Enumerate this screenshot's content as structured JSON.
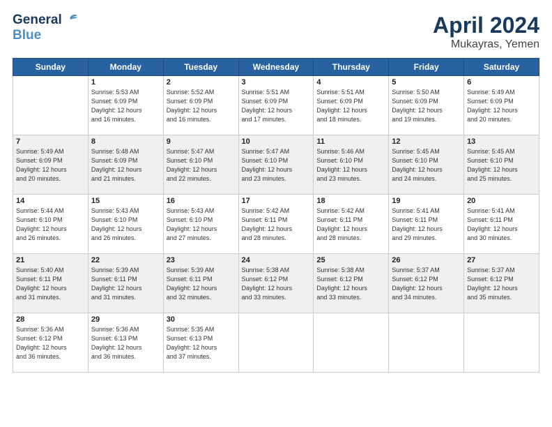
{
  "header": {
    "logo_line1": "General",
    "logo_line2": "Blue",
    "title": "April 2024",
    "location": "Mukayras, Yemen"
  },
  "days_of_week": [
    "Sunday",
    "Monday",
    "Tuesday",
    "Wednesday",
    "Thursday",
    "Friday",
    "Saturday"
  ],
  "weeks": [
    [
      {
        "num": "",
        "info": ""
      },
      {
        "num": "1",
        "info": "Sunrise: 5:53 AM\nSunset: 6:09 PM\nDaylight: 12 hours\nand 16 minutes."
      },
      {
        "num": "2",
        "info": "Sunrise: 5:52 AM\nSunset: 6:09 PM\nDaylight: 12 hours\nand 16 minutes."
      },
      {
        "num": "3",
        "info": "Sunrise: 5:51 AM\nSunset: 6:09 PM\nDaylight: 12 hours\nand 17 minutes."
      },
      {
        "num": "4",
        "info": "Sunrise: 5:51 AM\nSunset: 6:09 PM\nDaylight: 12 hours\nand 18 minutes."
      },
      {
        "num": "5",
        "info": "Sunrise: 5:50 AM\nSunset: 6:09 PM\nDaylight: 12 hours\nand 19 minutes."
      },
      {
        "num": "6",
        "info": "Sunrise: 5:49 AM\nSunset: 6:09 PM\nDaylight: 12 hours\nand 20 minutes."
      }
    ],
    [
      {
        "num": "7",
        "info": "Sunrise: 5:49 AM\nSunset: 6:09 PM\nDaylight: 12 hours\nand 20 minutes."
      },
      {
        "num": "8",
        "info": "Sunrise: 5:48 AM\nSunset: 6:09 PM\nDaylight: 12 hours\nand 21 minutes."
      },
      {
        "num": "9",
        "info": "Sunrise: 5:47 AM\nSunset: 6:10 PM\nDaylight: 12 hours\nand 22 minutes."
      },
      {
        "num": "10",
        "info": "Sunrise: 5:47 AM\nSunset: 6:10 PM\nDaylight: 12 hours\nand 23 minutes."
      },
      {
        "num": "11",
        "info": "Sunrise: 5:46 AM\nSunset: 6:10 PM\nDaylight: 12 hours\nand 23 minutes."
      },
      {
        "num": "12",
        "info": "Sunrise: 5:45 AM\nSunset: 6:10 PM\nDaylight: 12 hours\nand 24 minutes."
      },
      {
        "num": "13",
        "info": "Sunrise: 5:45 AM\nSunset: 6:10 PM\nDaylight: 12 hours\nand 25 minutes."
      }
    ],
    [
      {
        "num": "14",
        "info": "Sunrise: 5:44 AM\nSunset: 6:10 PM\nDaylight: 12 hours\nand 26 minutes."
      },
      {
        "num": "15",
        "info": "Sunrise: 5:43 AM\nSunset: 6:10 PM\nDaylight: 12 hours\nand 26 minutes."
      },
      {
        "num": "16",
        "info": "Sunrise: 5:43 AM\nSunset: 6:10 PM\nDaylight: 12 hours\nand 27 minutes."
      },
      {
        "num": "17",
        "info": "Sunrise: 5:42 AM\nSunset: 6:11 PM\nDaylight: 12 hours\nand 28 minutes."
      },
      {
        "num": "18",
        "info": "Sunrise: 5:42 AM\nSunset: 6:11 PM\nDaylight: 12 hours\nand 28 minutes."
      },
      {
        "num": "19",
        "info": "Sunrise: 5:41 AM\nSunset: 6:11 PM\nDaylight: 12 hours\nand 29 minutes."
      },
      {
        "num": "20",
        "info": "Sunrise: 5:41 AM\nSunset: 6:11 PM\nDaylight: 12 hours\nand 30 minutes."
      }
    ],
    [
      {
        "num": "21",
        "info": "Sunrise: 5:40 AM\nSunset: 6:11 PM\nDaylight: 12 hours\nand 31 minutes."
      },
      {
        "num": "22",
        "info": "Sunrise: 5:39 AM\nSunset: 6:11 PM\nDaylight: 12 hours\nand 31 minutes."
      },
      {
        "num": "23",
        "info": "Sunrise: 5:39 AM\nSunset: 6:11 PM\nDaylight: 12 hours\nand 32 minutes."
      },
      {
        "num": "24",
        "info": "Sunrise: 5:38 AM\nSunset: 6:12 PM\nDaylight: 12 hours\nand 33 minutes."
      },
      {
        "num": "25",
        "info": "Sunrise: 5:38 AM\nSunset: 6:12 PM\nDaylight: 12 hours\nand 33 minutes."
      },
      {
        "num": "26",
        "info": "Sunrise: 5:37 AM\nSunset: 6:12 PM\nDaylight: 12 hours\nand 34 minutes."
      },
      {
        "num": "27",
        "info": "Sunrise: 5:37 AM\nSunset: 6:12 PM\nDaylight: 12 hours\nand 35 minutes."
      }
    ],
    [
      {
        "num": "28",
        "info": "Sunrise: 5:36 AM\nSunset: 6:12 PM\nDaylight: 12 hours\nand 36 minutes."
      },
      {
        "num": "29",
        "info": "Sunrise: 5:36 AM\nSunset: 6:13 PM\nDaylight: 12 hours\nand 36 minutes."
      },
      {
        "num": "30",
        "info": "Sunrise: 5:35 AM\nSunset: 6:13 PM\nDaylight: 12 hours\nand 37 minutes."
      },
      {
        "num": "",
        "info": ""
      },
      {
        "num": "",
        "info": ""
      },
      {
        "num": "",
        "info": ""
      },
      {
        "num": "",
        "info": ""
      }
    ]
  ]
}
